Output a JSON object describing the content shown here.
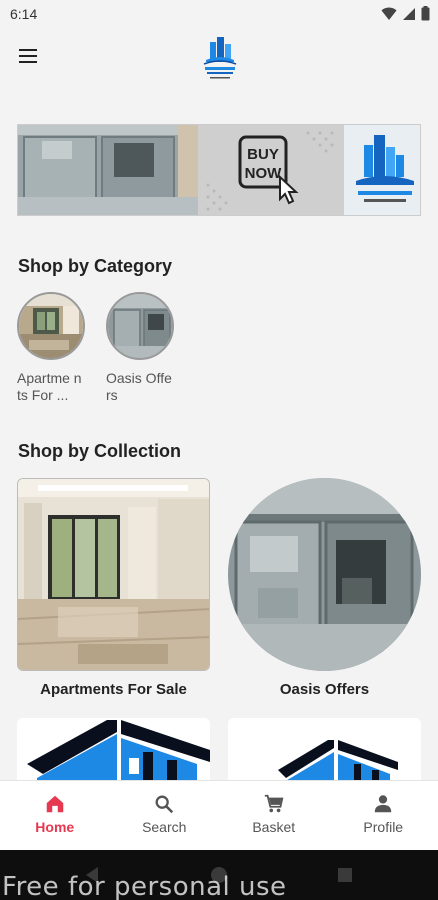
{
  "status": {
    "time": "6:14"
  },
  "header": {
    "menu_icon": "hamburger-menu-icon",
    "logo_icon": "company-logo"
  },
  "banner": {
    "cta_text": "BUY\nNOW",
    "cta_line1": "BUY",
    "cta_line2": "NOW"
  },
  "categories": {
    "title": "Shop by Category",
    "items": [
      {
        "label": "Apartments For Sale",
        "display": "Apartme nts For ..."
      },
      {
        "label": "Oasis Offers",
        "display": "Oasis Offers"
      }
    ]
  },
  "collections": {
    "title": "Shop by Collection",
    "items": [
      {
        "label": "Apartments For Sale"
      },
      {
        "label": "Oasis Offers"
      }
    ]
  },
  "bottom_nav": {
    "items": [
      {
        "label": "Home",
        "icon": "home-icon",
        "active": true
      },
      {
        "label": "Search",
        "icon": "search-icon",
        "active": false
      },
      {
        "label": "Basket",
        "icon": "cart-icon",
        "active": false
      },
      {
        "label": "Profile",
        "icon": "person-icon",
        "active": false
      }
    ]
  },
  "watermark": {
    "text": "Free for personal use"
  },
  "colors": {
    "accent": "#e53951",
    "background": "#f3f3f3",
    "logo_blue": "#1e88e5"
  }
}
